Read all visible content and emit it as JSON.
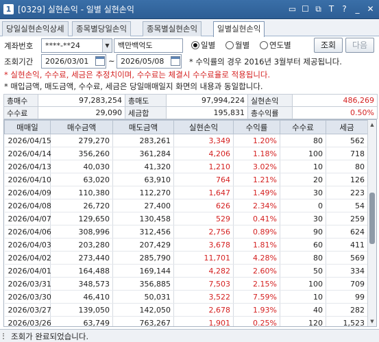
{
  "window": {
    "number": "1",
    "title": "[0329] 실현손익 - 일별 실현손익",
    "controls": [
      "▭",
      "☐",
      "⧉",
      "T",
      "?",
      "_",
      "✕"
    ]
  },
  "tabs": [
    "당일실현손익상세",
    "종목별당일손익",
    "종목별실현손익",
    "일별실현손익"
  ],
  "active_tab": 3,
  "form": {
    "account_label": "계좌번호",
    "account_value": "****-**24",
    "account_name": "백만백억도",
    "period_label": "조회기간",
    "date_from": "2026/03/01",
    "tilde": "~",
    "date_to": "2026/05/08",
    "radio_daily": "일별",
    "radio_monthly": "월별",
    "radio_yearly": "연도별",
    "period_note": "* 수익률의 경우 2016년 3월부터 제공됩니다.",
    "search_button": "조회",
    "next_button": "다음"
  },
  "notes": {
    "red": "* 실현손익, 수수료, 세금은 추정치이며, 수수료는 체결시 수수료율로 적용됩니다.",
    "black": "* 매입금액, 매도금액, 수수료, 세금은 당일매매일지 화면의 내용과 동일합니다."
  },
  "summary": {
    "row1": [
      {
        "label": "총매수",
        "value": "97,283,254"
      },
      {
        "label": "총매도",
        "value": "97,994,224"
      },
      {
        "label": "실현손익",
        "value": "486,269"
      }
    ],
    "row2": [
      {
        "label": "수수료",
        "value": "29,090"
      },
      {
        "label": "세금합",
        "value": "195,831"
      },
      {
        "label": "총수익률",
        "value": "0.50%"
      }
    ]
  },
  "grid": {
    "columns": [
      "매매일",
      "매수금액",
      "매도금액",
      "실현손익",
      "수익률",
      "수수료",
      "세금"
    ],
    "rows": [
      [
        "2026/04/15",
        "279,270",
        "283,261",
        "3,349",
        "1.20%",
        "80",
        "562"
      ],
      [
        "2026/04/14",
        "356,260",
        "361,284",
        "4,206",
        "1.18%",
        "100",
        "718"
      ],
      [
        "2026/04/13",
        "40,030",
        "41,320",
        "1,210",
        "3.02%",
        "10",
        "80"
      ],
      [
        "2026/04/10",
        "63,020",
        "63,910",
        "764",
        "1.21%",
        "20",
        "126"
      ],
      [
        "2026/04/09",
        "110,380",
        "112,270",
        "1,647",
        "1.49%",
        "30",
        "223"
      ],
      [
        "2026/04/08",
        "26,720",
        "27,400",
        "626",
        "2.34%",
        "0",
        "54"
      ],
      [
        "2026/04/07",
        "129,650",
        "130,458",
        "529",
        "0.41%",
        "30",
        "259"
      ],
      [
        "2026/04/06",
        "308,996",
        "312,456",
        "2,756",
        "0.89%",
        "90",
        "624"
      ],
      [
        "2026/04/03",
        "203,280",
        "207,429",
        "3,678",
        "1.81%",
        "60",
        "411"
      ],
      [
        "2026/04/02",
        "273,440",
        "285,790",
        "11,701",
        "4.28%",
        "80",
        "569"
      ],
      [
        "2026/04/01",
        "164,488",
        "169,144",
        "4,282",
        "2.60%",
        "50",
        "334"
      ],
      [
        "2026/03/31",
        "348,573",
        "356,885",
        "7,503",
        "2.15%",
        "100",
        "709"
      ],
      [
        "2026/03/30",
        "46,410",
        "50,031",
        "3,522",
        "7.59%",
        "10",
        "99"
      ],
      [
        "2026/03/27",
        "139,050",
        "142,050",
        "2,678",
        "1.93%",
        "40",
        "282"
      ],
      [
        "2026/03/26",
        "63,749",
        "763,267",
        "1,901",
        "0.25%",
        "120",
        "1,523"
      ]
    ],
    "red_columns": [
      3,
      4
    ]
  },
  "status": {
    "message": "조회가 완료되었습니다."
  },
  "colors": {
    "titlebar": "#2d5e95",
    "profit_red": "#d42020"
  }
}
